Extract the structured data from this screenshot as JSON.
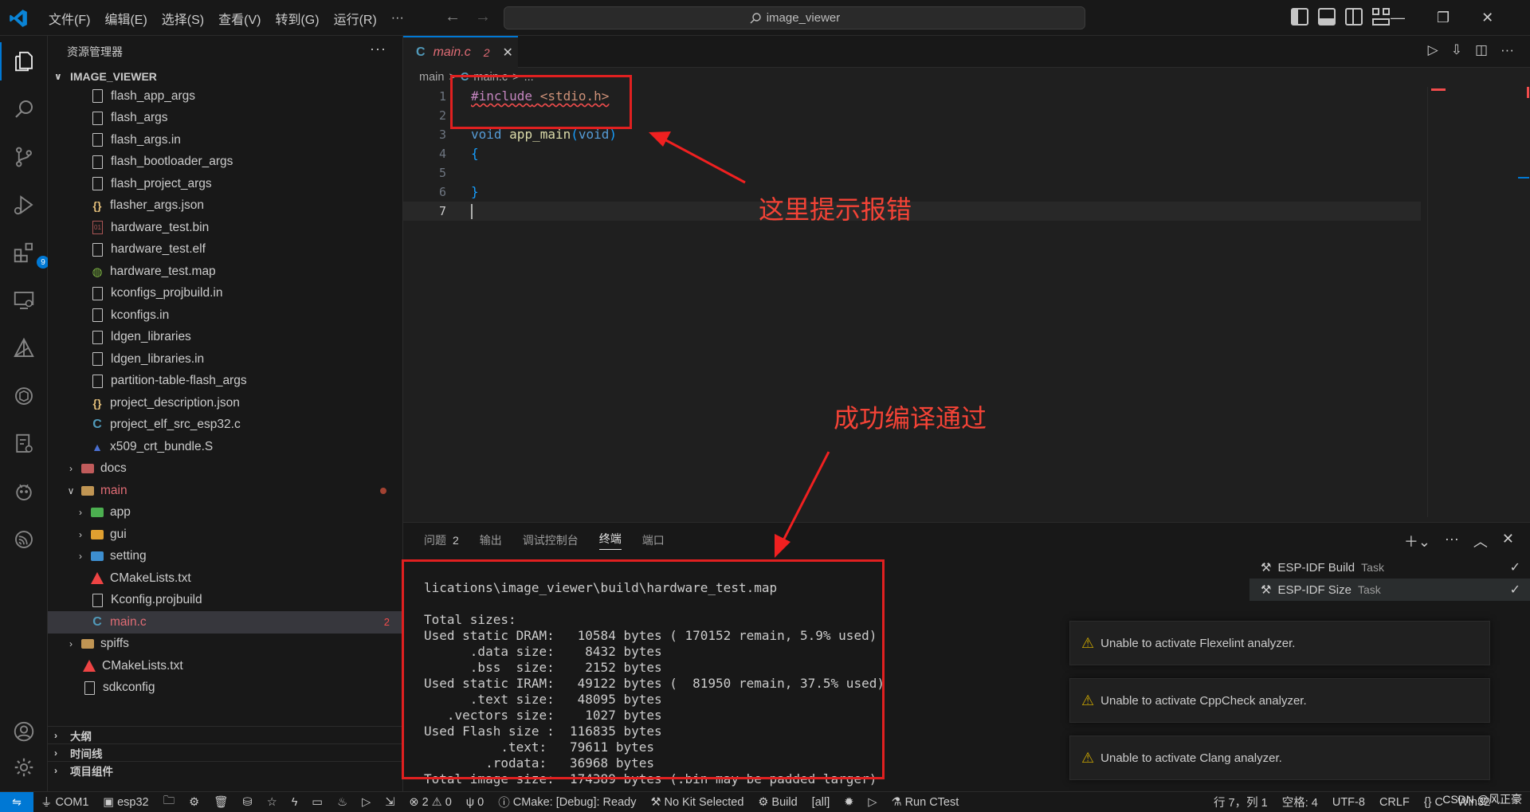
{
  "titlebar": {
    "menu": [
      "文件(F)",
      "编辑(E)",
      "选择(S)",
      "查看(V)",
      "转到(G)",
      "运行(R)",
      "···"
    ],
    "search_text": "image_viewer"
  },
  "activity": {
    "extensions_badge": "9"
  },
  "sidebar": {
    "header": "资源管理器",
    "more": "···",
    "root": "IMAGE_VIEWER",
    "files": [
      {
        "label": "flash_app_args",
        "icon": "file-icon"
      },
      {
        "label": "flash_args",
        "icon": "file-icon"
      },
      {
        "label": "flash_args.in",
        "icon": "file-icon"
      },
      {
        "label": "flash_bootloader_args",
        "icon": "file-icon"
      },
      {
        "label": "flash_project_args",
        "icon": "file-icon"
      },
      {
        "label": "flasher_args.json",
        "icon": "json-icon"
      },
      {
        "label": "hardware_test.bin",
        "icon": "binary-file-icon"
      },
      {
        "label": "hardware_test.elf",
        "icon": "file-icon"
      },
      {
        "label": "hardware_test.map",
        "icon": "globe-icon"
      },
      {
        "label": "kconfigs_projbuild.in",
        "icon": "file-icon"
      },
      {
        "label": "kconfigs.in",
        "icon": "file-icon"
      },
      {
        "label": "ldgen_libraries",
        "icon": "file-icon"
      },
      {
        "label": "ldgen_libraries.in",
        "icon": "file-icon"
      },
      {
        "label": "partition-table-flash_args",
        "icon": "file-icon"
      },
      {
        "label": "project_description.json",
        "icon": "json-icon"
      },
      {
        "label": "project_elf_src_esp32.c",
        "icon": "c-file-icon"
      },
      {
        "label": "x509_crt_bundle.S",
        "icon": "assembly-file-icon"
      }
    ],
    "docs": "docs",
    "main": "main",
    "main_children": [
      "app",
      "gui",
      "setting"
    ],
    "main_files": [
      "CMakeLists.txt",
      "Kconfig.projbuild",
      "main.c"
    ],
    "main_c_badge": "2",
    "spiffs": "spiffs",
    "root_files": [
      "CMakeLists.txt",
      "sdkconfig"
    ],
    "sections": [
      "大纲",
      "时间线",
      "项目组件"
    ]
  },
  "editor": {
    "tab_icon": "C",
    "tab_name": "main.c",
    "tab_problems": "2",
    "breadcrumb": [
      "main",
      ">",
      "C",
      "main.c",
      ">",
      "..."
    ],
    "line_numbers": [
      "1",
      "2",
      "3",
      "4",
      "5",
      "6",
      "7"
    ],
    "code": {
      "include_kw": "#include",
      "include_file": "<stdio.h>",
      "void1": "void",
      "fn": "app_main",
      "paren_open": "(",
      "void2": "void",
      "paren_close": ")",
      "open_brace": "{",
      "close_brace": "}"
    }
  },
  "panel": {
    "tabs": [
      "问题",
      "输出",
      "调试控制台",
      "终端",
      "端口"
    ],
    "problems_count": "2",
    "terminal_lines": [
      "lications\\image_viewer\\build\\hardware_test.map",
      "",
      "Total sizes:",
      "Used static DRAM:   10584 bytes ( 170152 remain, 5.9% used)",
      "      .data size:    8432 bytes",
      "      .bss  size:    2152 bytes",
      "Used static IRAM:   49122 bytes (  81950 remain, 37.5% used)",
      "      .text size:   48095 bytes",
      "   .vectors size:    1027 bytes",
      "Used Flash size :  116835 bytes",
      "          .text:   79611 bytes",
      "        .rodata:   36968 bytes",
      "Total image size:  174389 bytes (.bin may be padded larger)"
    ],
    "tasks": [
      {
        "name": "ESP-IDF Build",
        "type": "Task"
      },
      {
        "name": "ESP-IDF Size",
        "type": "Task"
      }
    ]
  },
  "notifications": [
    "Unable to activate Flexelint analyzer.",
    "Unable to activate CppCheck analyzer.",
    "Unable to activate Clang analyzer."
  ],
  "annotations": {
    "error_note": "这里提示报错",
    "success_note": "成功编译通过",
    "color": "#e02020"
  },
  "statusbar": {
    "items_left": [
      "COM1",
      "esp32",
      "",
      "",
      "",
      "",
      "",
      "",
      "",
      "",
      "",
      "",
      "⊗ 2 ⚠ 0",
      "ψ 0",
      "CMake: [Debug]: Ready",
      "No Kit Selected",
      "Build",
      "[all]",
      "",
      "",
      "Run CTest"
    ],
    "items_right": [
      "行 7，列 1",
      "空格: 4",
      "UTF-8",
      "CRLF",
      "{} C",
      "Win32"
    ],
    "watermark": "CSDN @风正豪"
  }
}
